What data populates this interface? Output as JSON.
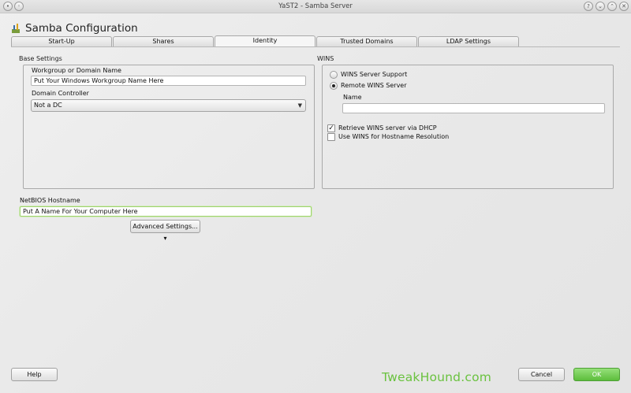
{
  "window": {
    "title": "YaST2 - Samba Server",
    "buttons": {
      "help": "?",
      "minimize": "⌄",
      "maximize": "⌃",
      "close": "✕"
    }
  },
  "header": {
    "title": "Samba Configuration",
    "icon": "samba-app-icon"
  },
  "tabs": [
    {
      "label": "Start-Up"
    },
    {
      "label": "Shares"
    },
    {
      "label": "Identity",
      "active": true
    },
    {
      "label": "Trusted Domains"
    },
    {
      "label": "LDAP Settings"
    }
  ],
  "base_settings": {
    "group_label": "Base Settings",
    "workgroup_label": "Workgroup or Domain Name",
    "workgroup_value": "Put Your Windows Workgroup Name Here",
    "domain_controller_label": "Domain Controller",
    "domain_controller_value": "Not a DC"
  },
  "wins": {
    "group_label": "WINS",
    "server_support_label": "WINS Server Support",
    "remote_server_label": "Remote WINS Server",
    "name_label": "Name",
    "name_value": "",
    "retrieve_dhcp_label": "Retrieve WINS server via DHCP",
    "retrieve_dhcp_checked": true,
    "use_wins_label": "Use WINS for Hostname Resolution",
    "use_wins_checked": false
  },
  "netbios": {
    "label": "NetBIOS Hostname",
    "value": "Put A Name For Your Computer Here",
    "advanced_button": "Advanced Settings...",
    "advanced_arrow": "▾"
  },
  "footer": {
    "help": "Help",
    "cancel": "Cancel",
    "ok": "OK",
    "watermark": "TweakHound.com"
  },
  "colors": {
    "ok_button": "#5cbd3c",
    "watermark": "#6ac23f",
    "focus_border": "#9fd270"
  }
}
